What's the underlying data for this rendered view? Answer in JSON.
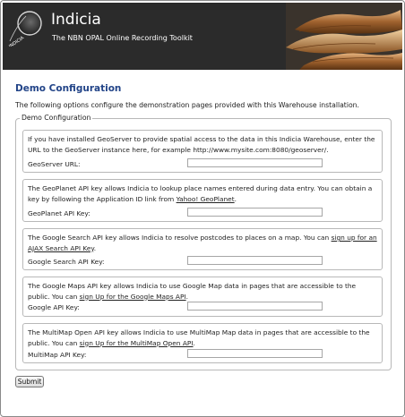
{
  "header": {
    "title": "Indicia",
    "subtitle": "The NBN OPAL Online Recording Toolkit",
    "logo_text": "INDICIA"
  },
  "page": {
    "heading": "Demo Configuration",
    "intro": "The following options configure the demonstration pages provided with this Warehouse installation.",
    "legend": "Demo Configuration"
  },
  "sections": {
    "geoserver": {
      "desc_pre": "If you have installed GeoServer to provide spatial access to the data in this Indicia Warehouse, enter the URL to the GeoServer instance here, for example http://www.mysite.com:8080/geoserver/.",
      "label": "GeoServer URL:",
      "value": ""
    },
    "geoplanet": {
      "desc_pre": "The GeoPlanet API key allows Indicia to lookup place names entered during data entry. You can obtain a key by following the Application ID link from ",
      "link": "Yahoo! GeoPlanet",
      "desc_post": ".",
      "label": "GeoPlanet API Key:",
      "value": ""
    },
    "google_search": {
      "desc_pre": "The Google Search API key allows Indicia to resolve postcodes to places on a map. You can ",
      "link": "sign up for an AJAX Search API Key",
      "desc_post": ".",
      "label": "Google Search API Key:",
      "value": ""
    },
    "google_maps": {
      "desc_pre": "The Google Maps API key allows Indicia to use Google Map data in pages that are accessible to the public. You can ",
      "link": "sign Up for the Google Maps API",
      "desc_post": ".",
      "label": "Google API Key:",
      "value": ""
    },
    "multimap": {
      "desc_pre": "The MultiMap Open API key allows Indicia to use MultiMap Map data in pages that are accessible to the public. You can ",
      "link": "sign Up for the MultiMap Open API",
      "desc_post": ".",
      "label": "MultiMap API Key:",
      "value": ""
    }
  },
  "submit_label": "Submit"
}
